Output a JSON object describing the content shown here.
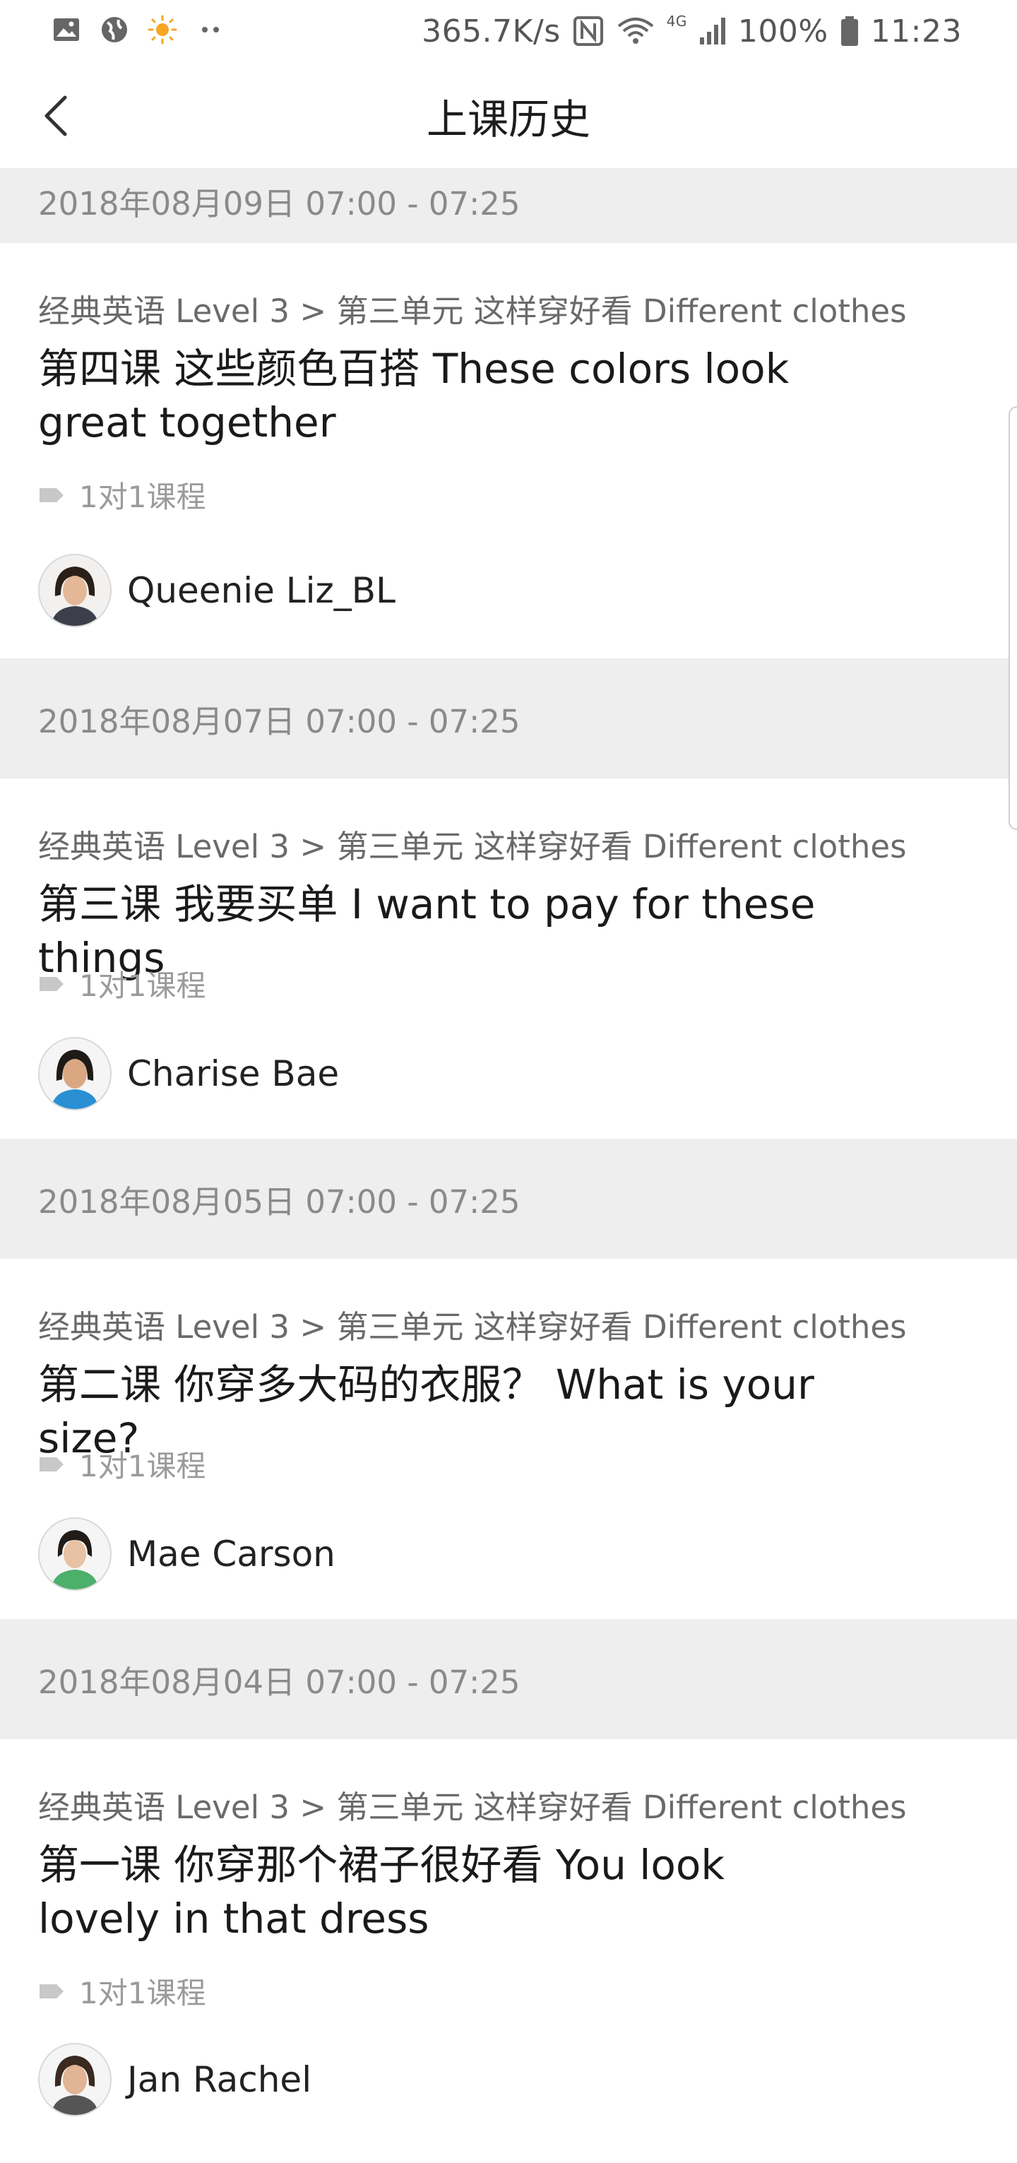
{
  "status_bar": {
    "speed": "365.7K/s",
    "network": "4G",
    "battery": "100%",
    "time": "11:23",
    "left_icons": [
      "image-icon",
      "globe-icon",
      "sun-icon",
      "more-dots-icon"
    ]
  },
  "header": {
    "title": "上课历史"
  },
  "sessions": [
    {
      "date": "2018年08月09日 07:00 - 07:25",
      "course_path": "经典英语 Level 3 > 第三单元 这样穿好看 Different clothes",
      "lesson_title": "第四课 这些颜色百搭  These colors look great together",
      "course_type": "1对1课程",
      "teacher": "Queenie Liz_BL"
    },
    {
      "date": "2018年08月07日 07:00 - 07:25",
      "course_path": "经典英语 Level 3 > 第三单元 这样穿好看 Different clothes",
      "lesson_title": "第三课 我要买单 I want to pay for these things",
      "course_type": "1对1课程",
      "teacher": "Charise Bae"
    },
    {
      "date": "2018年08月05日 07:00 - 07:25",
      "course_path": "经典英语 Level 3 > 第三单元 这样穿好看 Different clothes",
      "lesson_title": "第二课 你穿多大码的衣服？ What is your size?",
      "course_type": "1对1课程",
      "teacher": "Mae Carson"
    },
    {
      "date": "2018年08月04日 07:00 - 07:25",
      "course_path": "经典英语 Level 3 > 第三单元 这样穿好看 Different clothes",
      "lesson_title": "第一课 你穿那个裙子很好看 You look lovely in that dress",
      "course_type": "1对1课程",
      "teacher": "Jan Rachel"
    }
  ],
  "colors": {
    "date_band": "#eeeeee",
    "date_text": "#8a8a8a",
    "title_text": "#1a1a1a",
    "muted_text": "#9a9a9a"
  }
}
